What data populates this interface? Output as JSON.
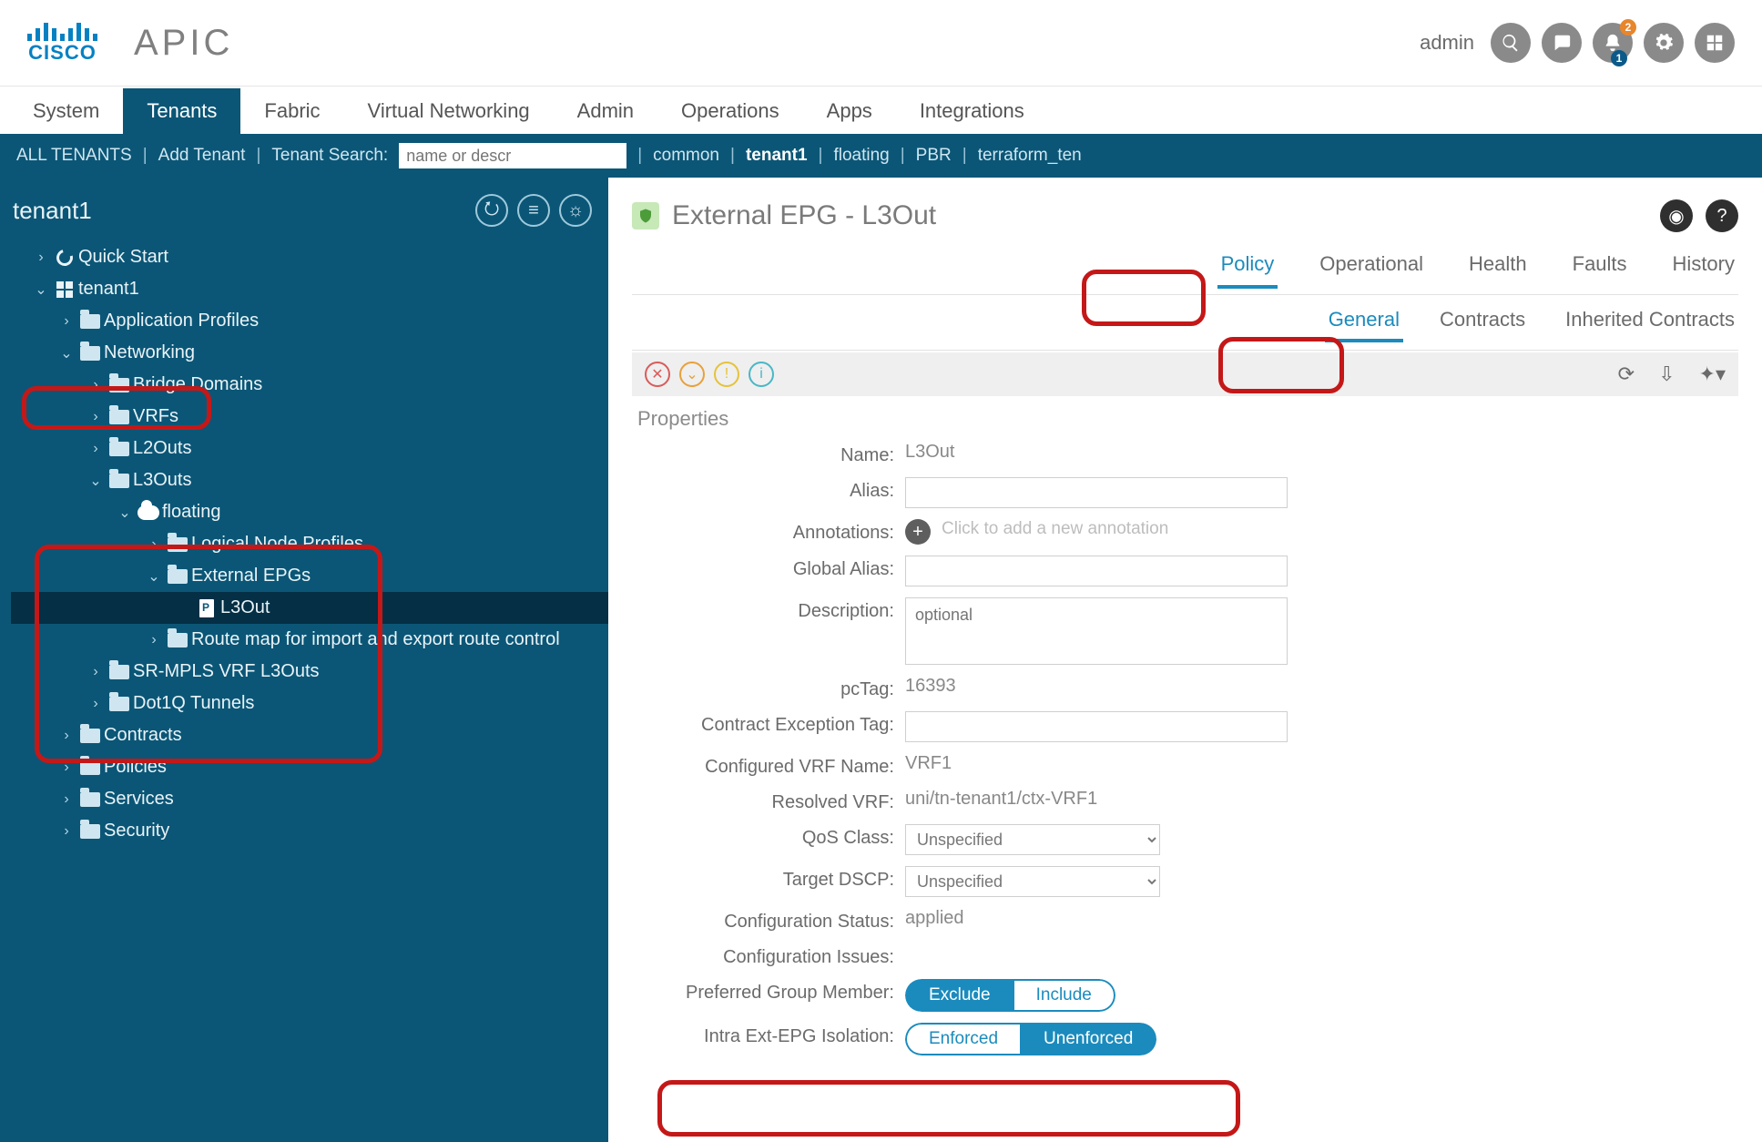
{
  "brand": {
    "cisco": "CISCO",
    "product": "APIC"
  },
  "user": {
    "name": "admin",
    "alert_badge_orange": "2",
    "alert_badge_blue": "1"
  },
  "mainnav": {
    "items": [
      "System",
      "Tenants",
      "Fabric",
      "Virtual Networking",
      "Admin",
      "Operations",
      "Apps",
      "Integrations"
    ],
    "active_index": 1
  },
  "subnav": {
    "all_tenants": "ALL TENANTS",
    "add_tenant": "Add Tenant",
    "search_label": "Tenant Search:",
    "search_placeholder": "name or descr",
    "links": [
      "common",
      "tenant1",
      "floating",
      "PBR",
      "terraform_ten"
    ],
    "active_link_index": 1
  },
  "sidebar": {
    "title": "tenant1",
    "tree": {
      "quick_start": "Quick Start",
      "tenant_root": "tenant1",
      "app_profiles": "Application Profiles",
      "networking": "Networking",
      "bridge_domains": "Bridge Domains",
      "vrfs": "VRFs",
      "l2outs": "L2Outs",
      "l3outs": "L3Outs",
      "floating": "floating",
      "logical_node_profiles": "Logical Node Profiles",
      "external_epgs": "External EPGs",
      "l3out_leaf": "L3Out",
      "route_map": "Route map for import and export route control",
      "sr_mpls": "SR-MPLS VRF L3Outs",
      "dot1q": "Dot1Q Tunnels",
      "contracts": "Contracts",
      "policies": "Policies",
      "services": "Services",
      "security": "Security"
    }
  },
  "content": {
    "title": "External EPG - L3Out",
    "tabs1": [
      "Policy",
      "Operational",
      "Health",
      "Faults",
      "History"
    ],
    "tabs1_active": 0,
    "tabs2": [
      "General",
      "Contracts",
      "Inherited Contracts"
    ],
    "tabs2_active": 0,
    "props_header": "Properties",
    "fields": {
      "name_lbl": "Name:",
      "name_val": "L3Out",
      "alias_lbl": "Alias:",
      "annotations_lbl": "Annotations:",
      "annotations_hint": "Click to add a new annotation",
      "global_alias_lbl": "Global Alias:",
      "description_lbl": "Description:",
      "description_ph": "optional",
      "pctag_lbl": "pcTag:",
      "pctag_val": "16393",
      "cet_lbl": "Contract Exception Tag:",
      "cvrf_lbl": "Configured VRF Name:",
      "cvrf_val": "VRF1",
      "rvrf_lbl": "Resolved VRF:",
      "rvrf_val": "uni/tn-tenant1/ctx-VRF1",
      "qos_lbl": "QoS Class:",
      "qos_val": "Unspecified",
      "dscp_lbl": "Target DSCP:",
      "dscp_val": "Unspecified",
      "cfg_status_lbl": "Configuration Status:",
      "cfg_status_val": "applied",
      "cfg_issues_lbl": "Configuration Issues:",
      "pgm_lbl": "Preferred Group Member:",
      "pgm_opts": [
        "Exclude",
        "Include"
      ],
      "pgm_sel": 0,
      "intra_lbl": "Intra Ext-EPG Isolation:",
      "intra_opts": [
        "Enforced",
        "Unenforced"
      ],
      "intra_sel": 1
    }
  }
}
